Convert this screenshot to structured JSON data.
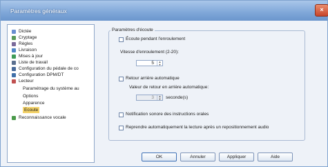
{
  "window": {
    "title": "Paramètres généraux",
    "close_label": "×"
  },
  "tree": [
    {
      "label": "Dictée",
      "icon": "dictation-icon",
      "color": "#6a8fd0"
    },
    {
      "label": "Cryptage",
      "icon": "encryption-icon",
      "color": "#5a9a5a"
    },
    {
      "label": "Règles",
      "icon": "rules-icon",
      "color": "#7a6a9a"
    },
    {
      "label": "Livraison",
      "icon": "delivery-icon",
      "color": "#4f86c6"
    },
    {
      "label": "Mises à jour",
      "icon": "update-icon",
      "color": "#3d9b57"
    },
    {
      "label": "Liste de travail",
      "icon": "worklist-icon",
      "color": "#5a6f8f"
    },
    {
      "label": "Configuration du pédale de co",
      "icon": "pedal-icon",
      "color": "#486a9a"
    },
    {
      "label": "Configuration DPM/DT",
      "icon": "dpm-icon",
      "color": "#3f6fa8"
    },
    {
      "label": "Lecteur",
      "icon": "player-icon",
      "color": "#c05050"
    },
    {
      "label": "Paramétrage du système au",
      "icon": "",
      "color": ""
    },
    {
      "label": "Options",
      "icon": "",
      "color": ""
    },
    {
      "label": "Apparence",
      "icon": "",
      "color": ""
    },
    {
      "label": "Ecoute",
      "icon": "",
      "color": ""
    },
    {
      "label": "Reconnaissance vocale",
      "icon": "voice-recognition-icon",
      "color": "#4a9a4a"
    }
  ],
  "settings": {
    "group_title": "Paramètres d'écoute",
    "listen_rewind": {
      "label": "Écoute pendant l'enroulement",
      "checked": false
    },
    "rewind_speed_label": "Vitesse d'enroulement (2-20):",
    "rewind_speed_value": "5",
    "auto_back": {
      "label": "Retour arrière automatique",
      "checked": false
    },
    "auto_back_value_label": "Valeur de retour en arrière automatique:",
    "auto_back_value": "3",
    "seconds_label": "seconde(s)",
    "audio_notification": {
      "label": "Notification sonore des instructions orales",
      "checked": false
    },
    "resume_playback": {
      "label": "Reprendre automatiquement la lecture après un repositionnement audio",
      "checked": false
    }
  },
  "buttons": {
    "ok": "OK",
    "cancel": "Annuler",
    "apply": "Appliquer",
    "help": "Aide"
  }
}
